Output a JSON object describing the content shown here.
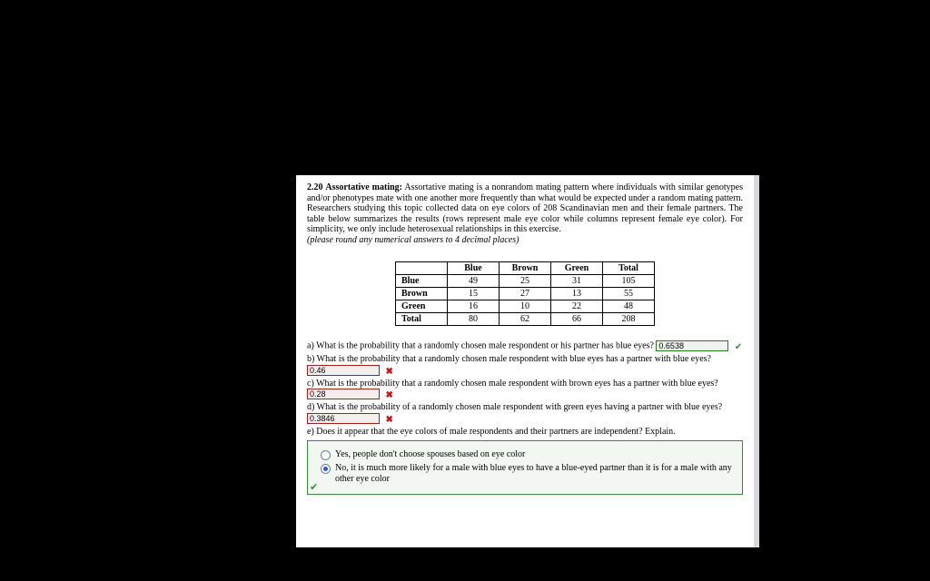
{
  "problem": {
    "number": "2.20",
    "title": "Assortative mating:",
    "body": "Assortative mating is a nonrandom mating pattern where individuals with similar genotypes and/or phenotypes mate with one another more frequently than what would be expected under a random mating pattern. Researchers studying this topic collected data on eye colors of 208 Scandinavian men and their female partners. The table below summarizes the results (rows represent male eye color while columns represent female eye color). For simplicity, we only include heterosexual relationships in this exercise.",
    "note": "(please round any numerical answers to 4 decimal places)"
  },
  "table": {
    "col_headers": [
      "Blue",
      "Brown",
      "Green",
      "Total"
    ],
    "rows": [
      {
        "label": "Blue",
        "cells": [
          "49",
          "25",
          "31",
          "105"
        ]
      },
      {
        "label": "Brown",
        "cells": [
          "15",
          "27",
          "13",
          "55"
        ]
      },
      {
        "label": "Green",
        "cells": [
          "16",
          "10",
          "22",
          "48"
        ]
      },
      {
        "label": "Total",
        "cells": [
          "80",
          "62",
          "66",
          "208"
        ]
      }
    ]
  },
  "questions": {
    "a": {
      "text": "a) What is the probability that a randomly chosen male respondent or his partner has blue eyes?",
      "value": "0.6538",
      "status": "correct"
    },
    "b": {
      "text": "b) What is the probability that a randomly chosen male respondent with blue eyes has a partner with blue eyes?",
      "value": "0.46",
      "status": "wrong"
    },
    "c": {
      "text": "c) What is the probability that a randomly chosen male respondent with brown eyes has a partner with blue eyes?",
      "value": "0.28",
      "status": "wrong"
    },
    "d": {
      "text": "d) What is the probability of a randomly chosen male respondent with green eyes having a partner with blue eyes?",
      "value": "0.3846",
      "status": "wrong"
    },
    "e": {
      "text": "e) Does it appear that the eye colors of male respondents and their partners are independent? Explain.",
      "opt1": "Yes, people don't choose spouses based on eye color",
      "opt2": "No, it is much more likely for a male with blue eyes to have a blue-eyed partner than it is for a male with any other eye color",
      "selected": "opt2",
      "status": "correct"
    }
  },
  "chart_data": {
    "type": "table",
    "title": "Eye color of male respondents vs female partners (counts)",
    "row_labels": [
      "Blue",
      "Brown",
      "Green",
      "Total"
    ],
    "col_labels": [
      "Blue",
      "Brown",
      "Green",
      "Total"
    ],
    "values": [
      [
        49,
        25,
        31,
        105
      ],
      [
        15,
        27,
        13,
        55
      ],
      [
        16,
        10,
        22,
        48
      ],
      [
        80,
        62,
        66,
        208
      ]
    ]
  }
}
